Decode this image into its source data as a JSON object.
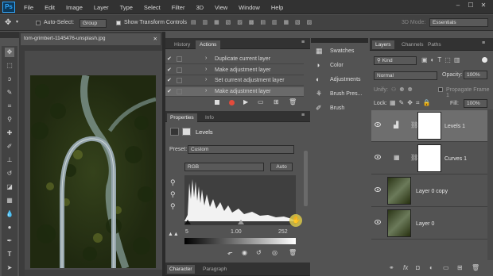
{
  "menubar": {
    "logo": "Ps",
    "items": [
      "File",
      "Edit",
      "Image",
      "Layer",
      "Type",
      "Select",
      "Filter",
      "3D",
      "View",
      "Window",
      "Help"
    ]
  },
  "options": {
    "auto_select_label": "Auto-Select:",
    "auto_select_value": "Group",
    "transform_label": "Show Transform Controls",
    "mode_3d": "3D Mode:",
    "workspace": "Essentials"
  },
  "document": {
    "tab": "tom-grimbert-1145476-unsplash.jpg"
  },
  "history": {
    "tabs": [
      "History",
      "Actions"
    ],
    "items": [
      "Duplicate current layer",
      "Make adjustment layer",
      "Set current adjustment layer",
      "Make adjustment layer"
    ]
  },
  "side_panel": {
    "items": [
      "Swatches",
      "Color",
      "Adjustments",
      "Brush Pres...",
      "Brush"
    ]
  },
  "properties": {
    "tabs": [
      "Properties",
      "Info"
    ],
    "title": "Levels",
    "preset_label": "Preset:",
    "preset_value": "Custom",
    "channel": "RGB",
    "auto_label": "Auto",
    "input_black": "5",
    "input_gamma": "1.00",
    "input_white": "252"
  },
  "bottom_tabs": [
    "Character",
    "Paragraph"
  ],
  "layers_panel": {
    "tabs": [
      "Layers",
      "Channels",
      "Paths"
    ],
    "kind": "Kind",
    "blend": "Normal",
    "opacity_label": "Opacity:",
    "opacity_value": "100%",
    "unify_label": "Unify:",
    "propagate": "Propagate Frame 1",
    "lock_label": "Lock:",
    "fill_label": "Fill:",
    "fill_value": "100%",
    "layers": [
      {
        "name": "Levels 1",
        "selected": true
      },
      {
        "name": "Curves 1",
        "selected": false
      },
      {
        "name": "Layer 0 copy",
        "selected": false
      },
      {
        "name": "Layer 0",
        "selected": false
      }
    ]
  }
}
